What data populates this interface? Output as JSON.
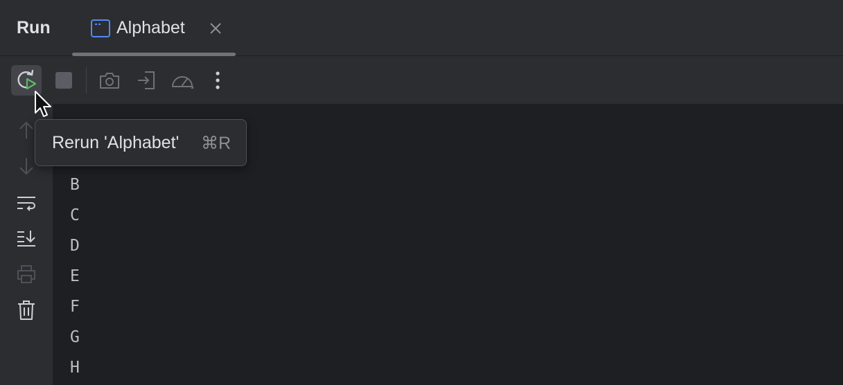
{
  "header": {
    "panel_title": "Run",
    "tab": {
      "label": "Alphabet",
      "icon": "console-window-icon",
      "close_icon": "close-icon"
    }
  },
  "toolbar": {
    "buttons": [
      {
        "name": "rerun",
        "icon": "rerun-icon",
        "active": true
      },
      {
        "name": "stop",
        "icon": "stop-icon",
        "enabled": false
      },
      {
        "name": "screenshot",
        "icon": "camera-icon",
        "enabled": false
      },
      {
        "name": "attach",
        "icon": "login-icon",
        "enabled": false
      },
      {
        "name": "profiler",
        "icon": "gauge-icon",
        "enabled": false
      },
      {
        "name": "more",
        "icon": "more-vertical-icon"
      }
    ]
  },
  "sidebar": {
    "buttons": [
      {
        "name": "up",
        "icon": "arrow-up-icon",
        "enabled": false
      },
      {
        "name": "down",
        "icon": "arrow-down-icon",
        "enabled": false
      },
      {
        "name": "soft-wrap",
        "icon": "soft-wrap-icon"
      },
      {
        "name": "scroll-to-end",
        "icon": "scroll-to-end-icon"
      },
      {
        "name": "print",
        "icon": "printer-icon",
        "enabled": false
      },
      {
        "name": "clear",
        "icon": "trash-icon"
      }
    ]
  },
  "console": {
    "lines": [
      "B",
      "C",
      "D",
      "E",
      "F",
      "G",
      "H"
    ]
  },
  "tooltip": {
    "text": "Rerun 'Alphabet'",
    "shortcut": "⌘R"
  },
  "colors": {
    "background": "#1e1f22",
    "panel": "#2b2d30",
    "text": "#dfe1e5",
    "run_green": "#5fb865",
    "tab_icon_blue": "#548af7"
  }
}
